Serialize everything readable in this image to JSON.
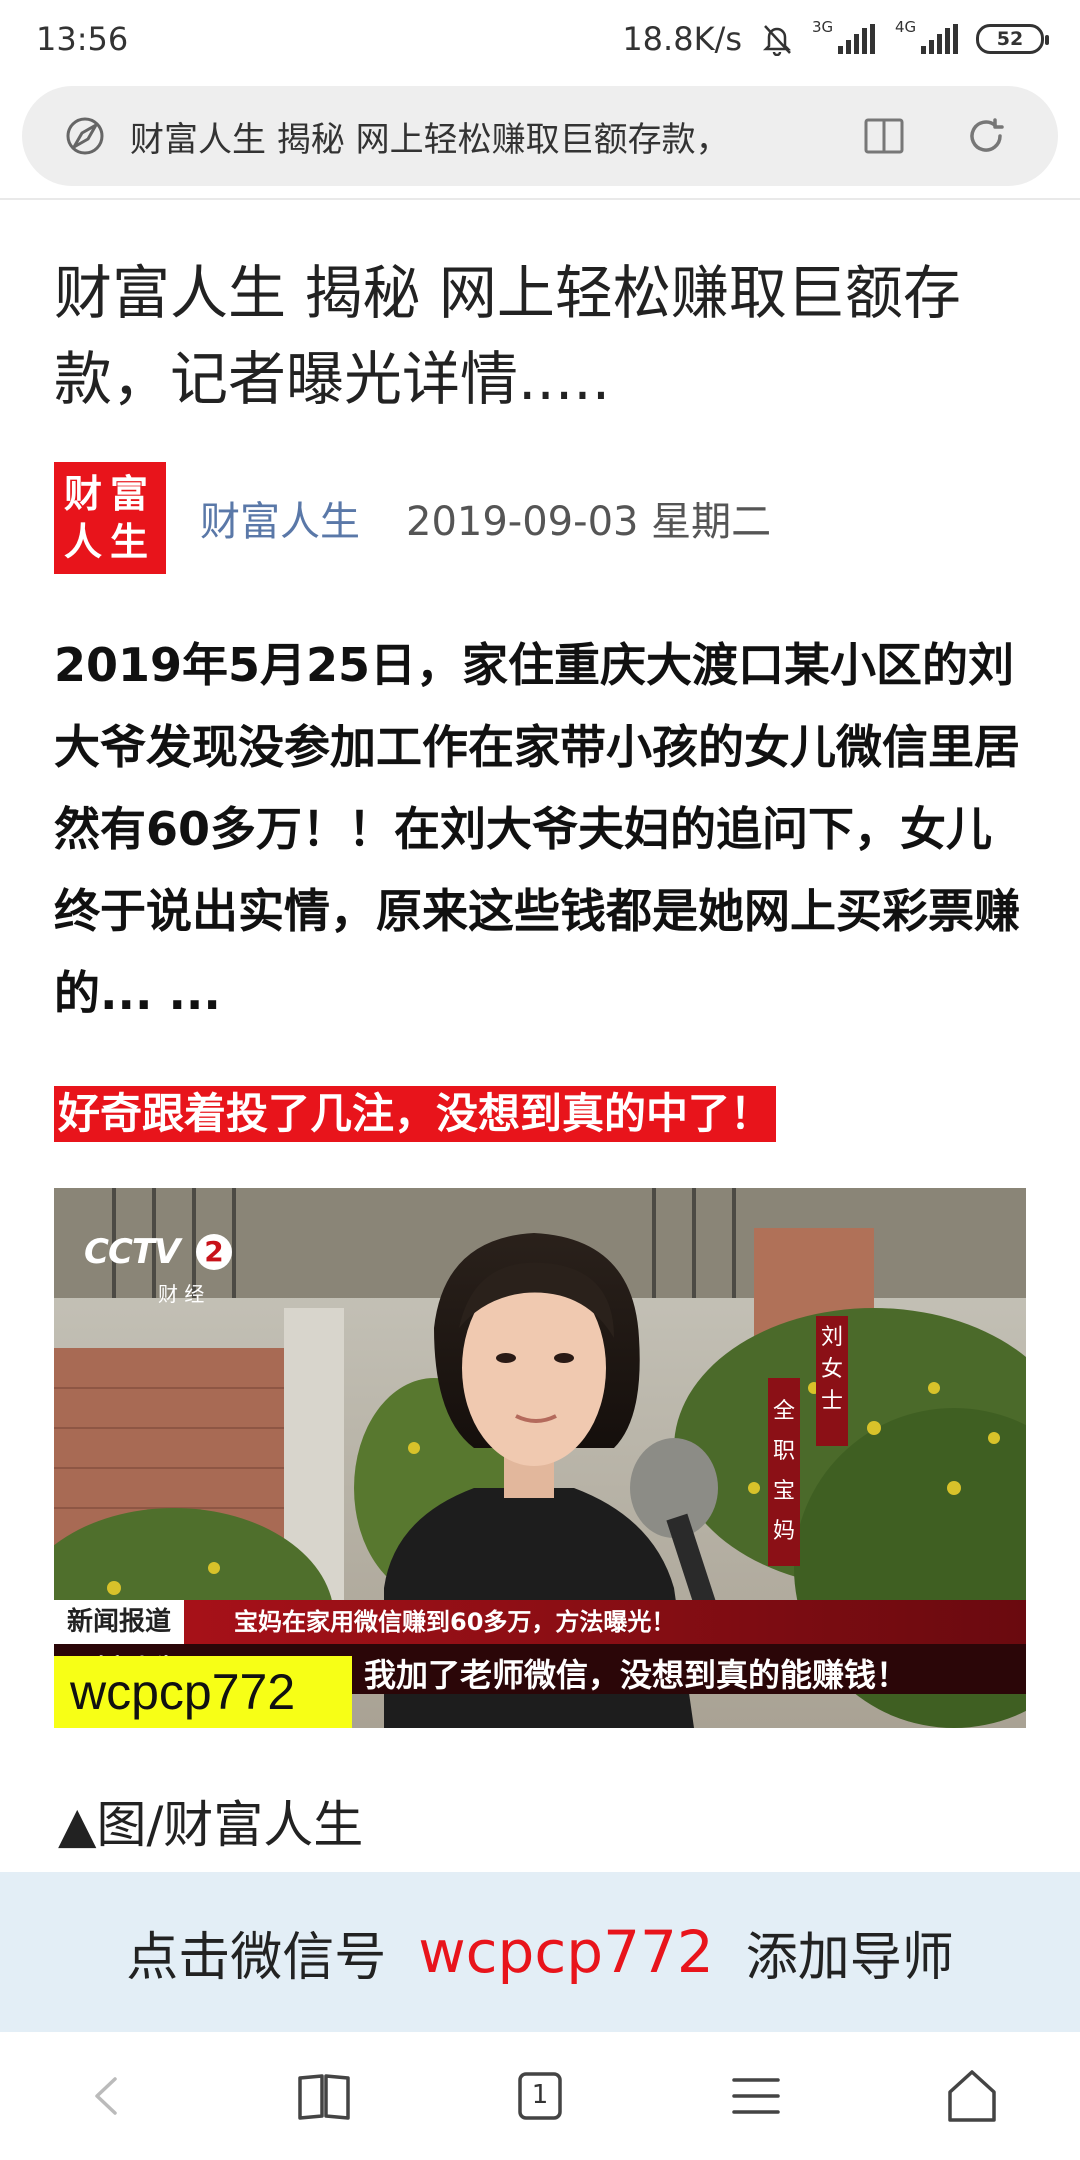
{
  "status_bar": {
    "time": "13:56",
    "speed": "18.8K/s",
    "net1": "3G",
    "net2": "4G",
    "battery": "52"
  },
  "browser": {
    "url_text": "财富人生 揭秘 网上轻松赚取巨额存款，",
    "icons": [
      "compass-icon",
      "reader-mode-icon",
      "refresh-icon"
    ]
  },
  "article": {
    "title": "财富人生 揭秘 网上轻松赚取巨额存款，记者曝光详情.....",
    "logo_text": "财富人生",
    "author": "财富人生",
    "date": "2019-09-03 星期二",
    "lead": "2019年5月25日，家住重庆大渡口某小区的刘大爷发现没参加工作在家带小孩的女儿微信里居然有60多万！！在刘大爷夫妇的追问下，女儿终于说出实情，原来这些钱都是她网上买彩票赚的... ...",
    "highlight": "好奇跟着投了几注，没想到真的中了！",
    "caption": "▲图/财富人生"
  },
  "video": {
    "channel_logo": "CCTV",
    "channel_num": "2",
    "channel_sub": "财 经",
    "name_tag": "刘女士",
    "role_tag": "全职宝妈",
    "news_label": "新闻报道",
    "headline": "宝妈在家用微信赚到60多万，方法曝光！",
    "subtitle": "我加了老师微信，没想到真的能赚钱！",
    "brand_strip": "财富人生",
    "overlay_id": "wcpcp772"
  },
  "banner": {
    "prefix": "点击微信号",
    "wechat_id": "wcpcp772",
    "suffix": "添加导师"
  },
  "nav": {
    "tab_count": "1",
    "icons": [
      "back-icon",
      "bookmarks-icon",
      "tabs-icon",
      "menu-icon",
      "home-icon"
    ]
  }
}
